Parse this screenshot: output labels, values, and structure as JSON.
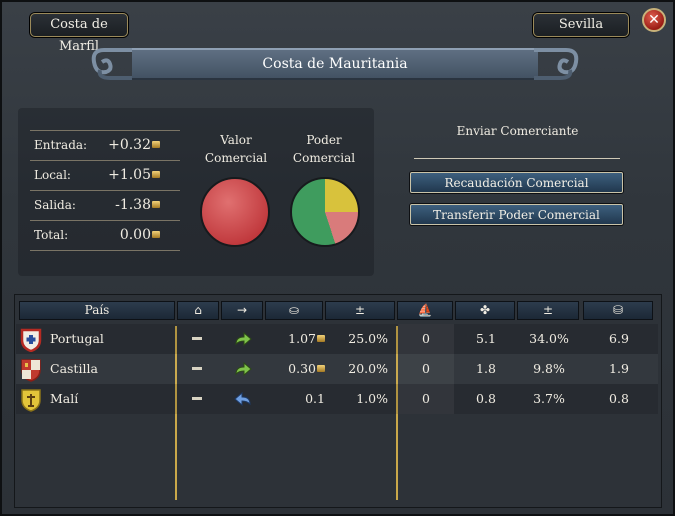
{
  "window": {
    "left_tab": "Costa de Marfil",
    "right_tab": "Sevilla",
    "close_glyph": "✕"
  },
  "title": "Costa de Mauritania",
  "stats": [
    {
      "label": "Entrada:",
      "value": "+0.32"
    },
    {
      "label": "Local:",
      "value": "+1.05"
    },
    {
      "label": "Salida:",
      "value": "-1.38"
    },
    {
      "label": "Total:",
      "value": "0.00"
    }
  ],
  "valor_comercial": {
    "line1": "Valor",
    "line2": "Comercial",
    "color": "#c0383c"
  },
  "poder_comercial": {
    "line1": "Poder",
    "line2": "Comercial",
    "slices": [
      {
        "share": 0.25,
        "color": "#d8c23c"
      },
      {
        "share": 0.2,
        "color": "#d97b7b"
      },
      {
        "share": 0.55,
        "color": "#3f9c5e"
      }
    ]
  },
  "enviar": {
    "title": "Enviar Comerciante",
    "button1": "Recaudación Comercial",
    "button2": "Transferir Poder Comercial"
  },
  "table": {
    "headers": {
      "pais": "País",
      "col_home": "home-icon",
      "col_arrow": "arrow-icon",
      "col_money": "coins-icon",
      "col_pm1": "±",
      "col_ship": "ship-icon",
      "col_hand": "handshake-icon",
      "col_pm2": "±",
      "col_hand2": "merchant-icon"
    },
    "rows": [
      {
        "name": "Portugal",
        "arrow": "forward",
        "money": "1.07",
        "pct1": "25.0%",
        "ships": "0",
        "power": "5.1",
        "pct2": "34.0%",
        "last": "6.9",
        "shield": "portugal"
      },
      {
        "name": "Castilla",
        "arrow": "forward",
        "money": "0.30",
        "pct1": "20.0%",
        "ships": "0",
        "power": "1.8",
        "pct2": "9.8%",
        "last": "1.9",
        "shield": "castilla"
      },
      {
        "name": "Malí",
        "arrow": "back",
        "money": "0.1",
        "pct1": "1.0%",
        "ships": "0",
        "power": "0.8",
        "pct2": "3.7%",
        "last": "0.8",
        "shield": "mali"
      }
    ]
  }
}
